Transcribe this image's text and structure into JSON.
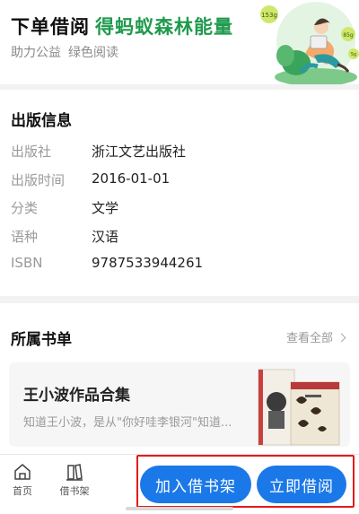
{
  "banner": {
    "title_part1": "下单借阅",
    "title_part2": "得蚂蚁森林能量",
    "sub1": "助力公益",
    "sub2": "绿色阅读",
    "energy_badge_1": "153g",
    "energy_badge_2": "85g",
    "energy_badge_3": "5g"
  },
  "publication": {
    "title": "出版信息",
    "rows": [
      {
        "label": "出版社",
        "value": "浙江文艺出版社"
      },
      {
        "label": "出版时间",
        "value": "2016-01-01"
      },
      {
        "label": "分类",
        "value": "文学"
      },
      {
        "label": "语种",
        "value": "汉语"
      },
      {
        "label": "ISBN",
        "value": "9787533944261"
      }
    ]
  },
  "booklist": {
    "title": "所属书单",
    "see_all": "查看全部",
    "item": {
      "name": "王小波作品合集",
      "desc": "知道王小波，是从\"你好哇李银河\"知道..."
    }
  },
  "bottom_bar": {
    "home_label": "首页",
    "shelf_label": "借书架",
    "add_button": "加入借书架",
    "borrow_button": "立即借阅"
  },
  "colors": {
    "brand_green": "#1f9a4d",
    "primary_blue": "#1b78e8",
    "highlight_red": "#e41b1b"
  }
}
